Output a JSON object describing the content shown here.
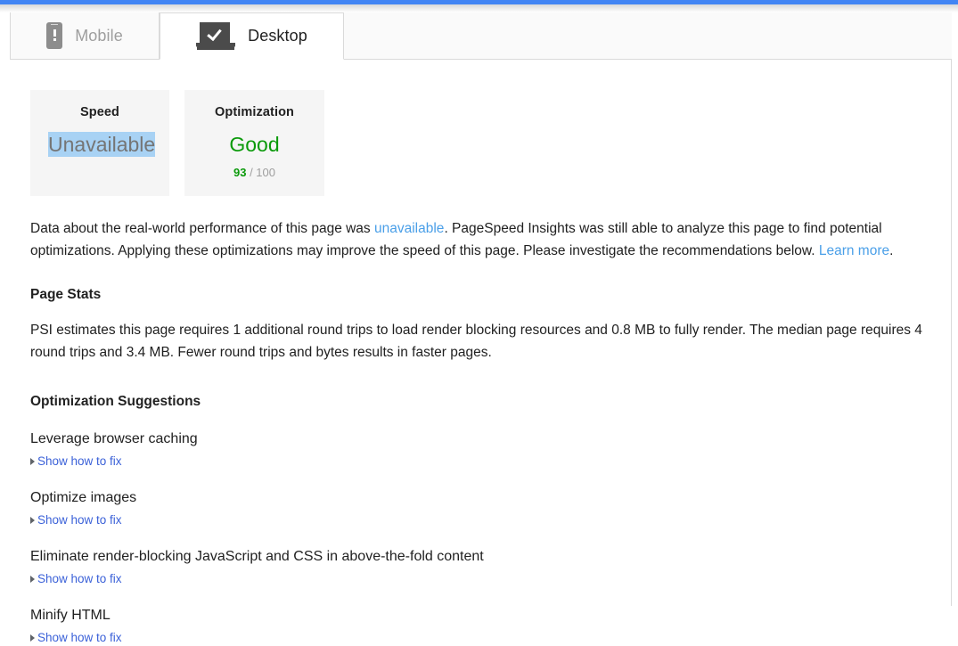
{
  "top_bar": {
    "color": "#4285f4"
  },
  "tabs": [
    {
      "id": "mobile",
      "label": "Mobile",
      "icon": "phone-warning-icon",
      "active": false
    },
    {
      "id": "desktop",
      "label": "Desktop",
      "icon": "laptop-check-icon",
      "active": true
    }
  ],
  "score_cards": [
    {
      "id": "speed",
      "title": "Speed",
      "value": "Unavailable",
      "value_color": "#757575",
      "selected": true,
      "sub_score": null,
      "sub_total": null
    },
    {
      "id": "optimization",
      "title": "Optimization",
      "value": "Good",
      "value_color": "#0b9a0b",
      "selected": false,
      "sub_score": "93",
      "sub_total": "/ 100"
    }
  ],
  "intro": {
    "text_before_link": "Data about the real-world performance of this page was ",
    "link1": "unavailable",
    "text_middle": ". PageSpeed Insights was still able to analyze this page to find potential optimizations. Applying these optimizations may improve the speed of this page. Please investigate the recommendations below. ",
    "link2": "Learn more",
    "text_after": "."
  },
  "page_stats": {
    "heading": "Page Stats",
    "body": "PSI estimates this page requires 1 additional round trips to load render blocking resources and 0.8 MB to fully render. The median page requires 4 round trips and 3.4 MB. Fewer round trips and bytes results in faster pages."
  },
  "suggestions": {
    "heading": "Optimization Suggestions",
    "toggle_label": "Show how to fix",
    "items": [
      {
        "title": "Leverage browser caching"
      },
      {
        "title": "Optimize images"
      },
      {
        "title": "Eliminate render-blocking JavaScript and CSS in above-the-fold content"
      },
      {
        "title": "Minify HTML"
      }
    ]
  },
  "colors": {
    "accent_blue": "#4285f4",
    "link_light_blue": "#4a9fe8",
    "link_blue": "#3b61d8",
    "good_green": "#0b9a0b",
    "selection_blue": "#a8d2f4"
  }
}
